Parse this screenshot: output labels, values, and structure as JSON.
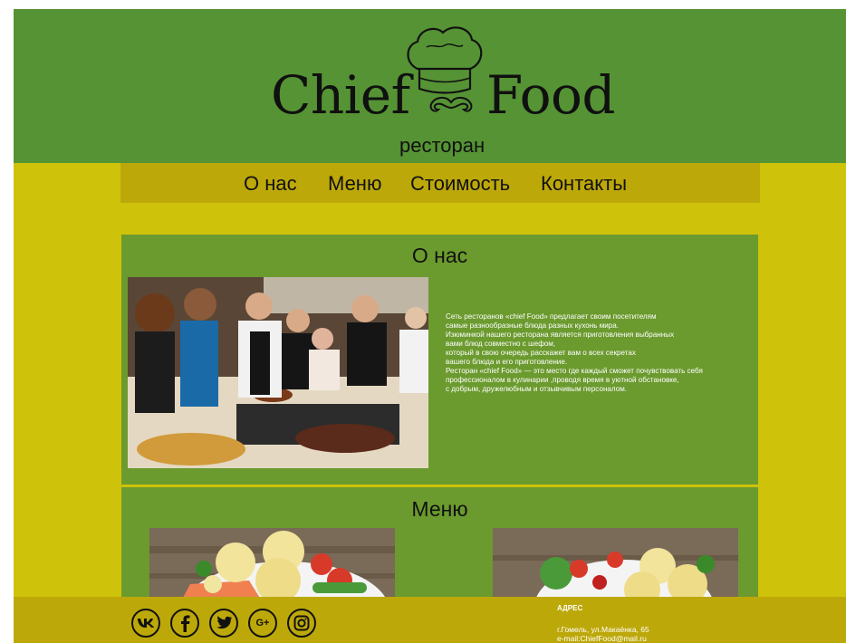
{
  "header": {
    "logo_left": "Chief",
    "logo_right": "Food",
    "logo_sub": "ресторан"
  },
  "nav": {
    "items": [
      {
        "label": "О нас"
      },
      {
        "label": "Меню"
      },
      {
        "label": "Стоимость"
      },
      {
        "label": "Контакты"
      }
    ]
  },
  "about": {
    "title": "О нас",
    "text": "Сеть ресторанов «chief Food» предлагает своим посетителям\nсамые разнообразные блюда разных кухонь мира.\nИзюминкой нашего ресторана является приготовления выбранных\nвами блюд совместно с шефом,\nкоторый в свою очередь расскажет вам о всех секретах\nвашего блюда и его приготовление.\nРесторан «chief Food» — это место где каждый сможет почувствовать себя\nпрофессионалом в кулинарии ,проводя время в уютной обстановке,\nс добрым, дружелюбным и отзывчивым персоналом."
  },
  "menu": {
    "title": "Меню"
  },
  "footer": {
    "social": [
      {
        "icon": "vk-icon",
        "glyph": "vk"
      },
      {
        "icon": "facebook-icon",
        "glyph": "f"
      },
      {
        "icon": "twitter-icon",
        "glyph": "t"
      },
      {
        "icon": "google-plus-icon",
        "glyph": "G+"
      },
      {
        "icon": "instagram-icon",
        "glyph": ""
      }
    ],
    "address_title": "АДРЕС",
    "address_line": "г.Гомель, ул.Макаёнка, 65",
    "email_line": "e-mail:ChiefFood@mail.ru"
  },
  "colors": {
    "header_green": "#559334",
    "page_yellow": "#cfc20a",
    "nav_gold": "#bda80a",
    "panel_green": "#6b9a2e"
  }
}
